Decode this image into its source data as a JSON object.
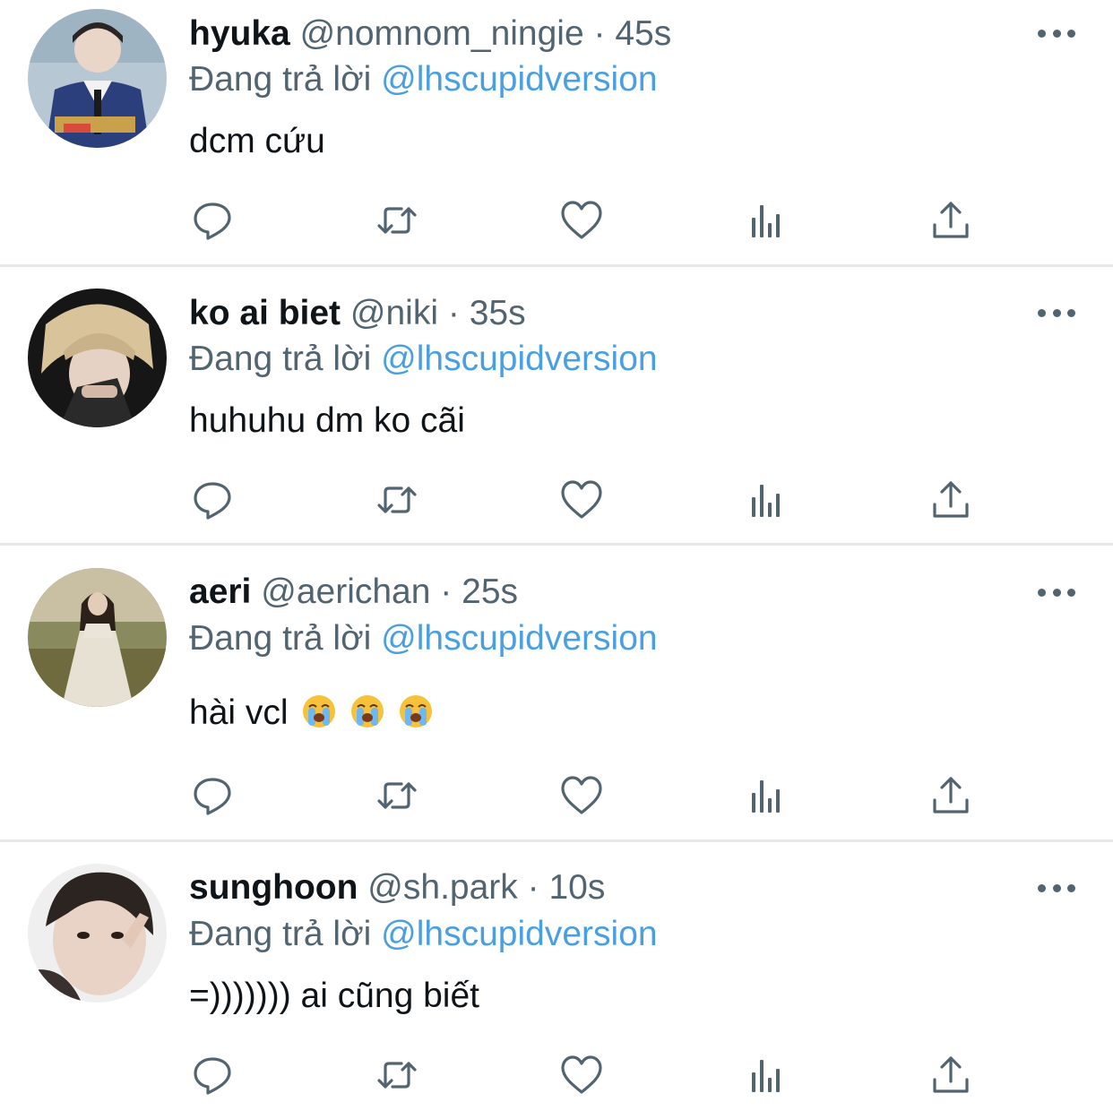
{
  "tweets": [
    {
      "display_name": "hyuka",
      "handle": "@nomnom_ningie",
      "separator": "·",
      "time": "45s",
      "reply_prefix": "Đang trả lời",
      "reply_to": "@lhscupidversion",
      "text": "dcm cứu",
      "avatar_colors": [
        "#b9c9d6",
        "#2c3e7a",
        "#f0f0f0"
      ]
    },
    {
      "display_name": "ko ai biet",
      "handle": "@niki",
      "separator": "·",
      "time": "35s",
      "reply_prefix": "Đang trả lời",
      "reply_to": "@lhscupidversion",
      "text": "huhuhu dm ko cãi",
      "avatar_colors": [
        "#1a1a1a",
        "#d9c6a0",
        "#3a3a3a"
      ]
    },
    {
      "display_name": "aeri",
      "handle": "@aerichan",
      "separator": "·",
      "time": "25s",
      "reply_prefix": "Đang trả lời",
      "reply_to": "@lhscupidversion",
      "text": "hài vcl",
      "emoji": [
        "loudly-crying-face-emoji",
        "loudly-crying-face-emoji",
        "loudly-crying-face-emoji"
      ],
      "avatar_colors": [
        "#8c8a5c",
        "#d8d3c2",
        "#2a2118"
      ]
    },
    {
      "display_name": "sunghoon",
      "handle": "@sh.park",
      "separator": "·",
      "time": "10s",
      "reply_prefix": "Đang trả lời",
      "reply_to": "@lhscupidversion",
      "text": "=))))))) ai cũng biết",
      "avatar_colors": [
        "#2b2320",
        "#e8d4c8",
        "#f3f3f3"
      ]
    }
  ],
  "actions": [
    "reply-icon",
    "retweet-icon",
    "like-icon",
    "analytics-icon",
    "share-icon"
  ],
  "colors": {
    "text": "#0f1419",
    "secondary": "#536471",
    "link": "#4a9fe3",
    "divider": "#e6e9ec",
    "icon": "#536471"
  }
}
